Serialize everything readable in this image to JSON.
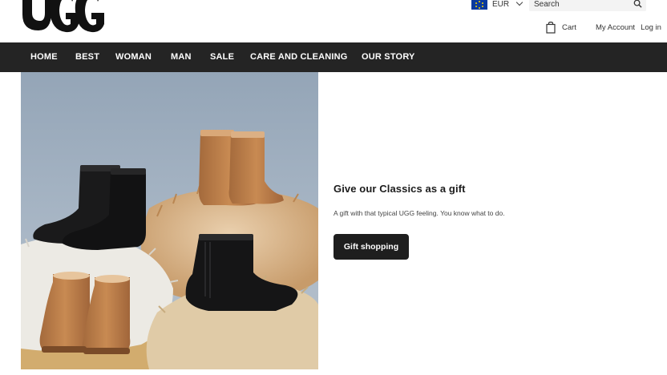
{
  "brand": {
    "logo_text": "UGG"
  },
  "header": {
    "currency": {
      "code": "EUR",
      "flag": "eu-flag-icon"
    },
    "search": {
      "placeholder": "Search"
    },
    "cart_label": "Cart",
    "my_account_label": "My Account",
    "login_label": "Log in"
  },
  "nav": {
    "items": [
      {
        "label": "HOME"
      },
      {
        "label": "BEST"
      },
      {
        "label": "WOMAN"
      },
      {
        "label": "MAN"
      },
      {
        "label": "SALE"
      },
      {
        "label": "CARE AND CLEANING"
      },
      {
        "label": "OUR STORY"
      }
    ]
  },
  "promo": {
    "title": "Give our Classics as a gift",
    "text": "A gift with that typical UGG feeling. You know what to do.",
    "button_label": "Gift shopping"
  },
  "colors": {
    "nav_bg": "#242424",
    "button_bg": "#1e1e1e",
    "eu_flag_blue": "#0a3a9e",
    "eu_flag_star": "#f5d400"
  }
}
